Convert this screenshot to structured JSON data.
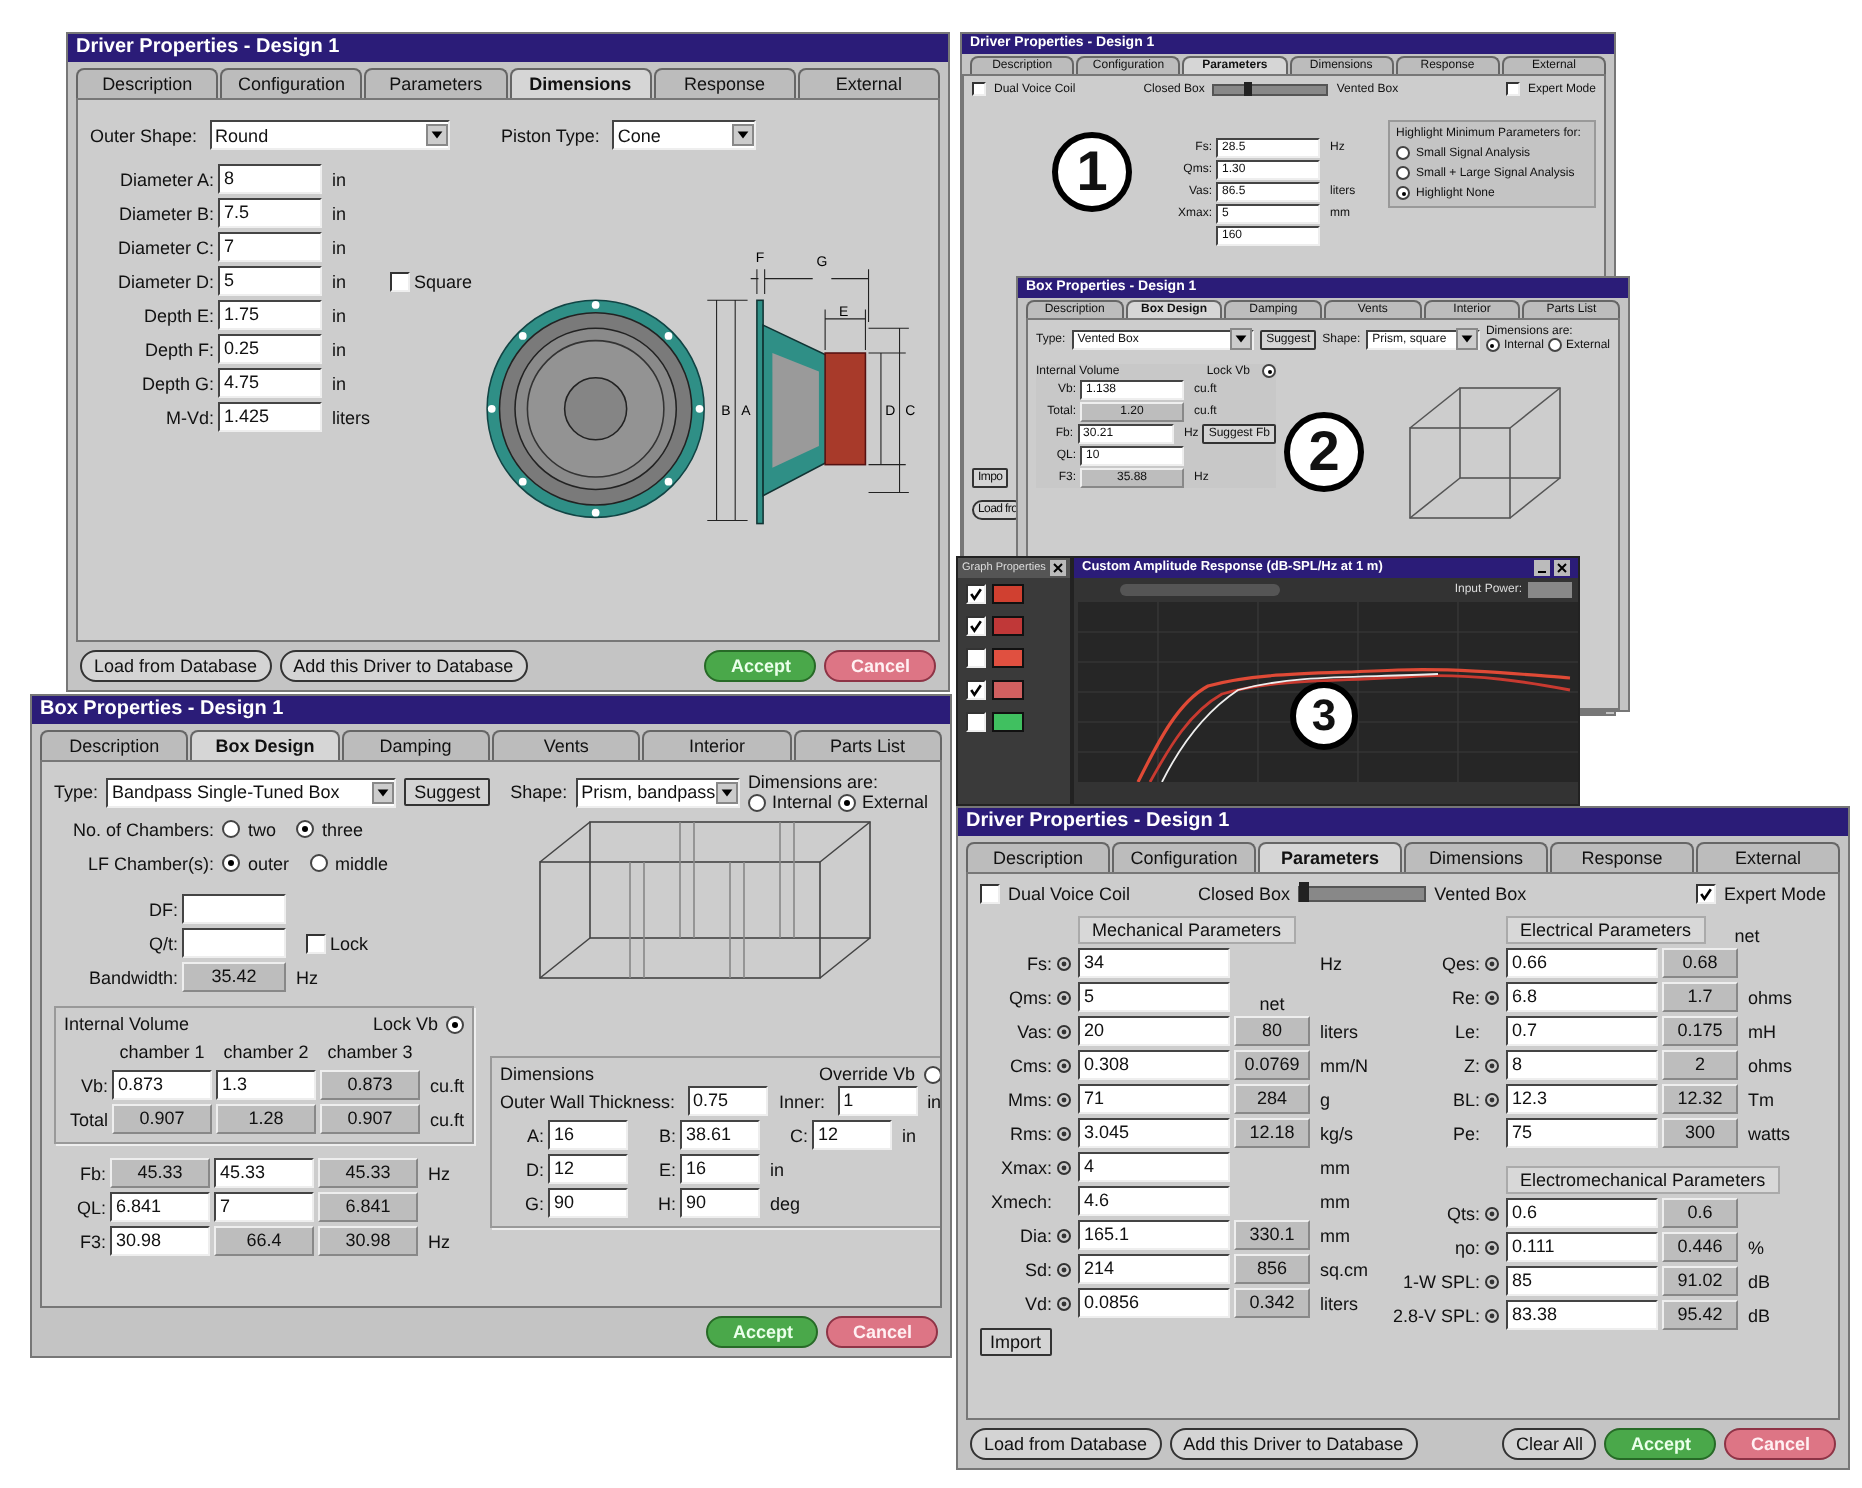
{
  "driver_dimensions_window": {
    "title": "Driver Properties - Design 1",
    "tabs": [
      {
        "label": "Description",
        "selected": false
      },
      {
        "label": "Configuration",
        "selected": false
      },
      {
        "label": "Parameters",
        "selected": false
      },
      {
        "label": "Dimensions",
        "selected": true
      },
      {
        "label": "Response",
        "selected": false
      },
      {
        "label": "External",
        "selected": false
      }
    ],
    "outer_shape": {
      "label": "Outer Shape:",
      "value": "Round"
    },
    "piston_type": {
      "label": "Piston Type:",
      "value": "Cone"
    },
    "fields": [
      {
        "label": "Diameter A:",
        "value": "8",
        "unit": "in"
      },
      {
        "label": "Diameter B:",
        "value": "7.5",
        "unit": "in"
      },
      {
        "label": "Diameter C:",
        "value": "7",
        "unit": "in"
      },
      {
        "label": "Diameter D:",
        "value": "5",
        "unit": "in"
      },
      {
        "label": "Depth E:",
        "value": "1.75",
        "unit": "in"
      },
      {
        "label": "Depth F:",
        "value": "0.25",
        "unit": "in"
      },
      {
        "label": "Depth G:",
        "value": "4.75",
        "unit": "in"
      },
      {
        "label": "M-Vd:",
        "value": "1.425",
        "unit": "liters"
      }
    ],
    "square": {
      "label": "Square",
      "checked": false
    },
    "dimension_labels": [
      "F",
      "G",
      "E",
      "B",
      "A",
      "D",
      "C"
    ],
    "left_buttons": [
      "Load from Database",
      "Add this Driver to Database"
    ],
    "accept": "Accept",
    "cancel": "Cancel"
  },
  "driver_parameters_back_window": {
    "title": "Driver Properties - Design 1",
    "tabs": [
      {
        "label": "Description",
        "selected": false
      },
      {
        "label": "Configuration",
        "selected": false
      },
      {
        "label": "Parameters",
        "selected": true
      },
      {
        "label": "Dimensions",
        "selected": false
      },
      {
        "label": "Response",
        "selected": false
      },
      {
        "label": "External",
        "selected": false
      }
    ],
    "dual_voice_coil": {
      "label": "Dual Voice Coil",
      "checked": false
    },
    "closed_box": "Closed Box",
    "box_slider": {
      "level": 0.3
    },
    "vented_box": "Vented Box",
    "expert_mode": {
      "label": "Expert Mode",
      "checked": false
    },
    "step": "1",
    "fields": [
      {
        "label": "Fs:",
        "value": "28.5",
        "unit": "Hz"
      },
      {
        "label": "Qms:",
        "value": "1.30"
      },
      {
        "label": "Vas:",
        "value": "86.5",
        "unit": "liters"
      },
      {
        "label": "Xmax:",
        "value": "5",
        "unit": "mm"
      },
      {
        "value": "160"
      }
    ],
    "highlight": {
      "title": "Highlight Minimum Parameters for:",
      "options": [
        {
          "label": "Small Signal Analysis",
          "selected": false
        },
        {
          "label": "Small + Large Signal Analysis",
          "selected": false
        },
        {
          "label": "Highlight None",
          "selected": true
        }
      ]
    },
    "import_button": "Impo",
    "load_button": "Load fro"
  },
  "box_back_window": {
    "title": "Box Properties - Design 1",
    "tabs": [
      {
        "label": "Description",
        "selected": false
      },
      {
        "label": "Box Design",
        "selected": true
      },
      {
        "label": "Damping",
        "selected": false
      },
      {
        "label": "Vents",
        "selected": false
      },
      {
        "label": "Interior",
        "selected": false
      },
      {
        "label": "Parts List",
        "selected": false
      }
    ],
    "type": {
      "label": "Type:",
      "value": "Vented Box"
    },
    "suggest": "Suggest",
    "shape": {
      "label": "Shape:",
      "value": "Prism, square"
    },
    "dimensions_are": {
      "label": "Dimensions are:",
      "options": [
        {
          "label": "Internal",
          "selected": true
        },
        {
          "label": "External",
          "selected": false
        }
      ]
    },
    "internal_volume": "Internal Volume",
    "lock_vb": {
      "label": "Lock Vb",
      "selected": true
    },
    "rows": [
      {
        "label": "Vb:",
        "value": "1.138",
        "editable": true,
        "unit": "cu.ft"
      },
      {
        "label": "Total:",
        "value": "1.20",
        "editable": false,
        "unit": "cu.ft"
      }
    ],
    "tuning": [
      {
        "label": "Fb:",
        "value": "30.21",
        "editable": true,
        "unit": "Hz"
      },
      {
        "label": "QL:",
        "value": "10",
        "editable": true
      },
      {
        "label": "F3:",
        "value": "35.88",
        "editable": false,
        "unit": "Hz"
      }
    ],
    "suggest_fb": "Suggest Fb",
    "step": "2"
  },
  "graph_window": {
    "properties_title": "Graph Properties",
    "items": [
      {
        "checked": true,
        "color": "#d04030"
      },
      {
        "checked": true,
        "color": "#c03838"
      },
      {
        "checked": false,
        "color": "#e05040"
      },
      {
        "checked": true,
        "color": "#d06060"
      },
      {
        "checked": false,
        "color": "#40c060"
      }
    ],
    "title": "Custom Amplitude Response (dB-SPL/Hz at 1 m)",
    "input_power": "Input Power:",
    "step": "3"
  },
  "box_design_window": {
    "title": "Box Properties - Design 1",
    "tabs": [
      {
        "label": "Description",
        "selected": false
      },
      {
        "label": "Box Design",
        "selected": true
      },
      {
        "label": "Damping",
        "selected": false
      },
      {
        "label": "Vents",
        "selected": false
      },
      {
        "label": "Interior",
        "selected": false
      },
      {
        "label": "Parts List",
        "selected": false
      }
    ],
    "type": {
      "label": "Type:",
      "value": "Bandpass Single-Tuned Box"
    },
    "suggest": "Suggest",
    "shape": {
      "label": "Shape:",
      "value": "Prism, bandpass"
    },
    "dimensions_are": {
      "label": "Dimensions are:",
      "options": [
        {
          "label": "Internal",
          "selected": false
        },
        {
          "label": "External",
          "selected": true
        }
      ]
    },
    "chambers": {
      "label": "No. of Chambers:",
      "options": [
        {
          "label": "two",
          "selected": false
        },
        {
          "label": "three",
          "selected": true
        }
      ]
    },
    "lf_chambers": {
      "label": "LF Chamber(s):",
      "options": [
        {
          "label": "outer",
          "selected": true
        },
        {
          "label": "middle",
          "selected": false
        }
      ]
    },
    "df": {
      "label": "DF:"
    },
    "qt": {
      "label": "Q/t:"
    },
    "lock": {
      "label": "Lock",
      "checked": false
    },
    "bandwidth": {
      "label": "Bandwidth:",
      "value": "35.42",
      "unit": "Hz"
    },
    "internal_volume": {
      "title": "Internal Volume",
      "lock_vb": {
        "label": "Lock Vb",
        "selected": true
      },
      "columns": [
        "chamber 1",
        "chamber 2",
        "chamber 3"
      ],
      "rows": [
        {
          "label": "Vb:",
          "cells": [
            {
              "value": "0.873",
              "editable": true
            },
            {
              "value": "1.3",
              "editable": true
            },
            {
              "value": "0.873",
              "editable": false
            }
          ],
          "unit": "cu.ft"
        },
        {
          "label": "Total",
          "cells": [
            {
              "value": "0.907",
              "editable": false
            },
            {
              "value": "1.28",
              "editable": false
            },
            {
              "value": "0.907",
              "editable": false
            }
          ],
          "unit": "cu.ft"
        }
      ]
    },
    "tuning": [
      {
        "label": "Fb:",
        "cells": [
          {
            "value": "45.33",
            "editable": false
          },
          {
            "value": "45.33",
            "editable": true
          },
          {
            "value": "45.33",
            "editable": false
          }
        ],
        "unit": "Hz"
      },
      {
        "label": "QL:",
        "cells": [
          {
            "value": "6.841",
            "editable": true
          },
          {
            "value": "7",
            "editable": true
          },
          {
            "value": "6.841",
            "editable": false
          }
        ]
      },
      {
        "label": "F3:",
        "cells": [
          {
            "value": "30.98",
            "editable": true
          },
          {
            "value": "66.4",
            "editable": false
          },
          {
            "value": "30.98",
            "editable": false
          }
        ],
        "unit": "Hz"
      }
    ],
    "dimensions": {
      "title": "Dimensions",
      "override_vb": {
        "label": "Override Vb",
        "selected": false
      },
      "wall": {
        "label": "Outer Wall Thickness:",
        "value": "0.75"
      },
      "inner": {
        "label": "Inner:",
        "value": "1",
        "unit": "in"
      },
      "rows": [
        {
          "cells": [
            {
              "label": "A:",
              "value": "16"
            },
            {
              "label": "B:",
              "value": "38.61"
            },
            {
              "label": "C:",
              "value": "12"
            }
          ],
          "unit": "in"
        },
        {
          "cells": [
            {
              "label": "D:",
              "value": "12"
            },
            {
              "label": "E:",
              "value": "16"
            }
          ],
          "unit": "in"
        },
        {
          "cells": [
            {
              "label": "G:",
              "value": "90"
            },
            {
              "label": "H:",
              "value": "90"
            }
          ],
          "unit": "deg"
        }
      ]
    },
    "accept": "Accept",
    "cancel": "Cancel"
  },
  "driver_parameters_window": {
    "title": "Driver Properties - Design 1",
    "tabs": [
      {
        "label": "Description",
        "selected": false
      },
      {
        "label": "Configuration",
        "selected": false
      },
      {
        "label": "Parameters",
        "selected": true
      },
      {
        "label": "Dimensions",
        "selected": false
      },
      {
        "label": "Response",
        "selected": false
      },
      {
        "label": "External",
        "selected": false
      }
    ],
    "dual_voice_coil": {
      "label": "Dual Voice Coil",
      "checked": false
    },
    "closed_box": "Closed Box",
    "box_slider": {
      "level": 0.03
    },
    "vented_box": "Vented Box",
    "expert_mode": {
      "label": "Expert Mode",
      "checked": true
    },
    "mechanical": {
      "title": "Mechanical Parameters",
      "rows": [
        {
          "label": "Fs:",
          "lock_icon": true,
          "value": "34",
          "unit": "Hz"
        },
        {
          "label": "Qms:",
          "lock_icon": true,
          "value": "5",
          "net_heading": "net"
        },
        {
          "label": "Vas:",
          "lock_icon": true,
          "value": "20",
          "net": "80",
          "unit": "liters"
        },
        {
          "label": "Cms:",
          "lock_icon": true,
          "value": "0.308",
          "net": "0.0769",
          "unit": "mm/N"
        },
        {
          "label": "Mms:",
          "lock_icon": true,
          "value": "71",
          "net": "284",
          "unit": "g"
        },
        {
          "label": "Rms:",
          "lock_icon": true,
          "value": "3.045",
          "net": "12.18",
          "unit": "kg/s"
        },
        {
          "label": "Xmax:",
          "lock_icon": true,
          "value": "4",
          "unit": "mm"
        },
        {
          "label": "Xmech:",
          "lock_icon": false,
          "value": "4.6",
          "unit": "mm"
        },
        {
          "label": "Dia:",
          "lock_icon": true,
          "value": "165.1",
          "net": "330.1",
          "unit": "mm"
        },
        {
          "label": "Sd:",
          "lock_icon": true,
          "value": "214",
          "net": "856",
          "unit": "sq.cm"
        },
        {
          "label": "Vd:",
          "lock_icon": true,
          "value": "0.0856",
          "net": "0.342",
          "unit": "liters"
        }
      ]
    },
    "electrical": {
      "title": "Electrical Parameters",
      "net_heading": "net",
      "rows": [
        {
          "label": "Qes:",
          "lock_icon": true,
          "value": "0.66",
          "net": "0.68"
        },
        {
          "label": "Re:",
          "lock_icon": true,
          "value": "6.8",
          "net": "1.7",
          "unit": "ohms"
        },
        {
          "label": "Le:",
          "lock_icon": false,
          "value": "0.7",
          "net": "0.175",
          "unit": "mH"
        },
        {
          "label": "Z:",
          "lock_icon": true,
          "value": "8",
          "net": "2",
          "unit": "ohms"
        },
        {
          "label": "BL:",
          "lock_icon": true,
          "value": "12.3",
          "net": "12.32",
          "unit": "Tm"
        },
        {
          "label": "Pe:",
          "lock_icon": false,
          "value": "75",
          "net": "300",
          "unit": "watts"
        }
      ]
    },
    "electromechanical": {
      "title": "Electromechanical Parameters",
      "rows": [
        {
          "label": "Qts:",
          "lock_icon": true,
          "value": "0.6",
          "net": "0.6"
        },
        {
          "label": "ηo:",
          "lock_icon": true,
          "value": "0.111",
          "net": "0.446",
          "unit": "%"
        },
        {
          "label": "1-W SPL:",
          "lock_icon": true,
          "value": "85",
          "net": "91.02",
          "unit": "dB"
        },
        {
          "label": "2.8-V SPL:",
          "lock_icon": true,
          "value": "83.38",
          "net": "95.42",
          "unit": "dB"
        }
      ]
    },
    "import": "Import",
    "left_buttons": [
      "Load from Database",
      "Add this Driver to Database"
    ],
    "clear_all": "Clear All",
    "accept": "Accept",
    "cancel": "Cancel"
  }
}
